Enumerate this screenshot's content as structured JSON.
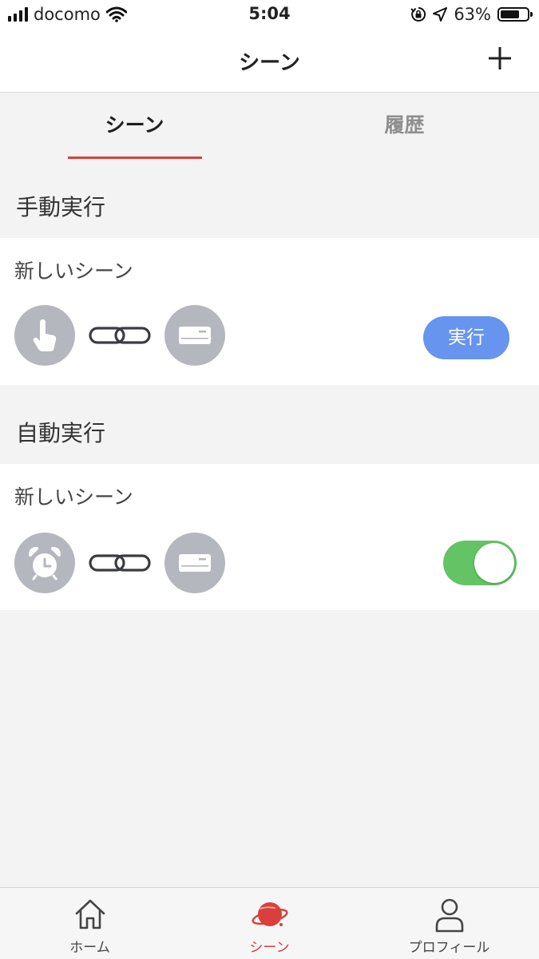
{
  "status_bar": {
    "carrier": "docomo",
    "time": "5:04",
    "battery_percent": "63%",
    "battery_level": 0.63,
    "icons": [
      "signal-icon",
      "wifi-icon",
      "rotation-lock-icon",
      "location-arrow-icon",
      "battery-icon"
    ]
  },
  "header": {
    "title": "シーン",
    "add_icon": "plus-icon"
  },
  "tabs": [
    {
      "label": "シーン",
      "active": true
    },
    {
      "label": "履歴",
      "active": false
    }
  ],
  "sections": {
    "manual": {
      "title": "手動実行",
      "card": {
        "name": "新しいシーン",
        "trigger_icon": "tap-hand-icon",
        "link_icon": "link-chain-icon",
        "device_icon": "air-conditioner-icon",
        "run_label": "実行"
      }
    },
    "auto": {
      "title": "自動実行",
      "card": {
        "name": "新しいシーン",
        "trigger_icon": "alarm-clock-icon",
        "link_icon": "link-chain-icon",
        "device_icon": "air-conditioner-icon",
        "enabled": true
      }
    }
  },
  "bottom_nav": [
    {
      "label": "ホーム",
      "icon": "home-icon",
      "active": false
    },
    {
      "label": "シーン",
      "icon": "scene-planet-icon",
      "active": true
    },
    {
      "label": "プロフィール",
      "icon": "profile-icon",
      "active": false
    }
  ],
  "colors": {
    "accent_red": "#d9403d",
    "run_blue": "#6694ee",
    "toggle_green": "#64c465",
    "icon_gray": "#b5b7bf",
    "background": "#f3f3f3"
  }
}
